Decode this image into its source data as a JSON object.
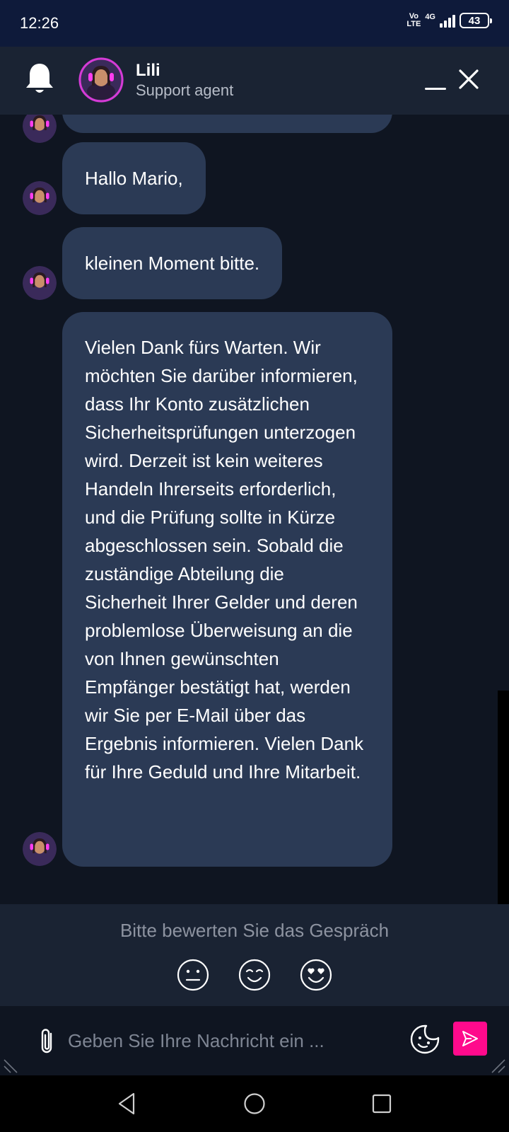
{
  "status_bar": {
    "time": "12:26",
    "volte_top": "Vo",
    "volte_bottom": "LTE",
    "network": "4G",
    "battery": "43"
  },
  "header": {
    "agent_name": "Lili",
    "agent_role": "Support agent"
  },
  "messages": [
    {
      "text": "Hallo Mario,"
    },
    {
      "text": "kleinen Moment bitte."
    },
    {
      "text": "Vielen Dank fürs Warten. Wir möchten Sie darüber informieren, dass Ihr Konto zusätzlichen Sicherheitsprüfungen unterzogen wird. Derzeit ist kein weiteres Handeln Ihrerseits erforderlich, und die Prüfung sollte in Kürze abgeschlossen sein. Sobald die zuständige Abteilung die Sicherheit Ihrer Gelder und deren problemlose Überweisung an die von Ihnen gewünschten Empfänger bestätigt hat, werden wir Sie per E-Mail über das Ergebnis informieren. Vielen Dank für Ihre Geduld und Ihre Mitarbeit."
    }
  ],
  "rating": {
    "prompt": "Bitte bewerten Sie das Gespräch",
    "options": [
      "neutral-face-icon",
      "smiling-face-icon",
      "heart-eyes-face-icon"
    ]
  },
  "composer": {
    "placeholder": "Geben Sie Ihre Nachricht ein ..."
  },
  "colors": {
    "accent": "#ff0a8c",
    "bubble": "#2b3a55",
    "header": "#1a2333",
    "background": "#0f1521"
  }
}
